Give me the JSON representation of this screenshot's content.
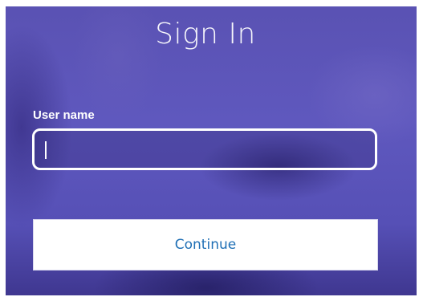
{
  "signin": {
    "title": "Sign In",
    "username_label": "User name",
    "username_value": "",
    "username_placeholder": "",
    "continue_label": "Continue"
  },
  "colors": {
    "background": "#5a52b3",
    "text": "#ffffff",
    "button_bg": "#ffffff",
    "button_text": "#1f6fb5"
  }
}
